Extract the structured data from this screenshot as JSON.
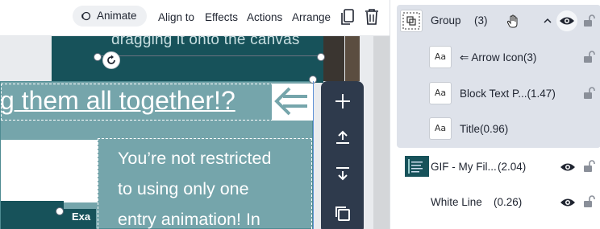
{
  "toolbar": {
    "animate_label": "Animate",
    "align_label": "Align to",
    "effects_label": "Effects",
    "actions_label": "Actions",
    "arrange_label": "Arrange"
  },
  "canvas": {
    "top_text": "dragging it onto the canvas",
    "headline": "g them all together!?",
    "body_lines": [
      "You’re not restricted",
      "to using only one",
      "entry animation! In"
    ],
    "small_label": "Exa"
  },
  "layers": {
    "group": {
      "name": "Group",
      "count": "(3)"
    },
    "children": [
      {
        "name": "⇐ Arrow Icon(3)",
        "thumb": "Aa"
      },
      {
        "name": "Block Text P...(1.47)",
        "thumb": "Aa"
      },
      {
        "name": "Title(0.96)",
        "thumb": "Aa"
      }
    ],
    "gif": {
      "name": "GIF - My Fil...",
      "count": "(2.04)"
    },
    "white_line": {
      "name": "White Line",
      "count": "(0.26)"
    }
  },
  "colors": {
    "teal_dark": "#17525a",
    "teal_light": "#75a5ab",
    "vbar": "#2e3a4c",
    "group_bg": "#dee2ea"
  }
}
